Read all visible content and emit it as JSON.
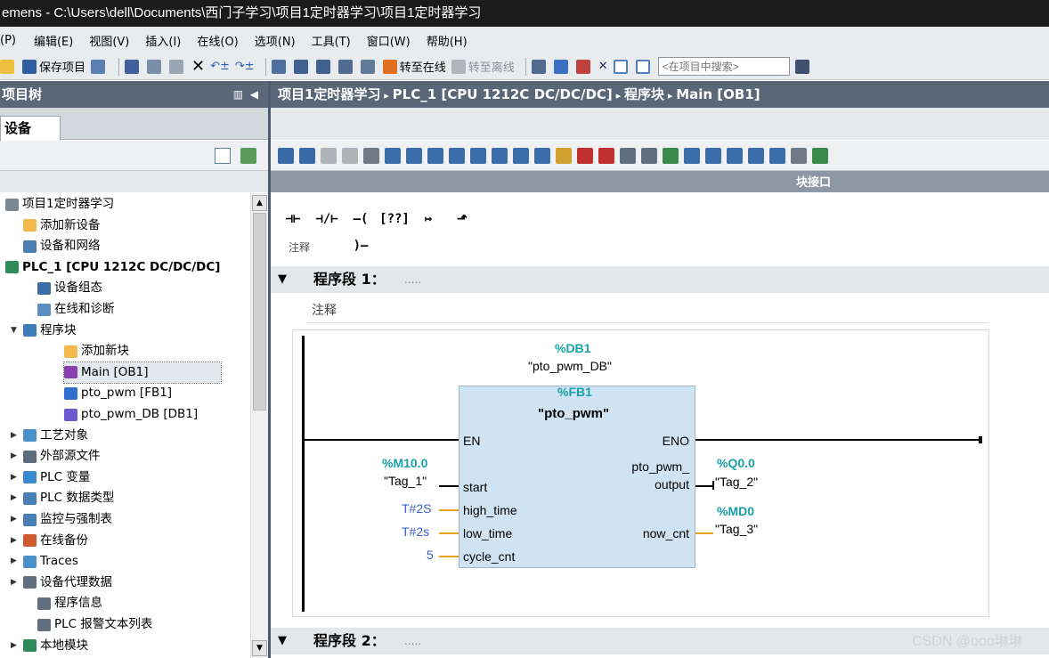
{
  "window": {
    "title": "emens  -  C:\\Users\\dell\\Documents\\西门子学习\\项目1定时器学习\\项目1定时器学习"
  },
  "menu": [
    "(P)",
    "编辑(E)",
    "视图(V)",
    "插入(I)",
    "在线(O)",
    "选项(N)",
    "工具(T)",
    "窗口(W)",
    "帮助(H)"
  ],
  "toolbar": {
    "save_label": "保存项目",
    "go_online": "转至在线",
    "go_offline": "转至离线",
    "search_placeholder": "<在项目中搜索>"
  },
  "left_pane": {
    "header": "项目树",
    "tab": "设备",
    "tree": [
      {
        "label": "项目1定时器学习",
        "level": 0,
        "arrow": "",
        "icon_color": "#7a8896"
      },
      {
        "label": "添加新设备",
        "level": 1,
        "arrow": "",
        "icon_color": "#f2b84b"
      },
      {
        "label": "设备和网络",
        "level": 1,
        "arrow": "",
        "icon_color": "#4d7fb5"
      },
      {
        "label": "PLC_1 [CPU 1212C DC/DC/DC]",
        "level": 0,
        "arrow": "▼",
        "icon_color": "#2e8b57"
      },
      {
        "label": "设备组态",
        "level": 2,
        "arrow": "",
        "icon_color": "#3a6ea5"
      },
      {
        "label": "在线和诊断",
        "level": 2,
        "arrow": "",
        "icon_color": "#5a8fc0"
      },
      {
        "label": "程序块",
        "level": 1,
        "arrow": "▼",
        "icon_color": "#3d7ab8"
      },
      {
        "label": "添加新块",
        "level": 3,
        "arrow": "",
        "icon_color": "#f2b84b"
      },
      {
        "label": "Main [OB1]",
        "level": 3,
        "arrow": "",
        "icon_color": "#8a3fb0",
        "selected": true
      },
      {
        "label": "pto_pwm [FB1]",
        "level": 3,
        "arrow": "",
        "icon_color": "#2f6fd0"
      },
      {
        "label": "pto_pwm_DB [DB1]",
        "level": 3,
        "arrow": "",
        "icon_color": "#6a5acd"
      },
      {
        "label": "工艺对象",
        "level": 1,
        "arrow": "▶",
        "icon_color": "#4a90c8"
      },
      {
        "label": "外部源文件",
        "level": 1,
        "arrow": "▶",
        "icon_color": "#5b6c7d"
      },
      {
        "label": "PLC 变量",
        "level": 1,
        "arrow": "▶",
        "icon_color": "#3b8ad0"
      },
      {
        "label": "PLC 数据类型",
        "level": 1,
        "arrow": "▶",
        "icon_color": "#4a7fb5"
      },
      {
        "label": "监控与强制表",
        "level": 1,
        "arrow": "▶",
        "icon_color": "#4a7fb5"
      },
      {
        "label": "在线备份",
        "level": 1,
        "arrow": "▶",
        "icon_color": "#d05a30"
      },
      {
        "label": "Traces",
        "level": 1,
        "arrow": "▶",
        "icon_color": "#4a90c8"
      },
      {
        "label": "设备代理数据",
        "level": 1,
        "arrow": "▶",
        "icon_color": "#607080"
      },
      {
        "label": "程序信息",
        "level": 2,
        "arrow": "",
        "icon_color": "#607080"
      },
      {
        "label": "PLC 报警文本列表",
        "level": 2,
        "arrow": "",
        "icon_color": "#607080"
      },
      {
        "label": "本地模块",
        "level": 1,
        "arrow": "▶",
        "icon_color": "#2e8b57"
      }
    ]
  },
  "breadcrumb": [
    "项目1定时器学习",
    "PLC_1 [CPU 1212C DC/DC/DC]",
    "程序块",
    "Main [OB1]"
  ],
  "block_interface_label": "块接口",
  "ladder_elements": [
    "⊣⊢",
    "⊣/⊢",
    "–( )–",
    "[??]",
    "↦",
    "⬏"
  ],
  "editor": {
    "top_comment": "注释",
    "network1": {
      "title": "程序段 1：",
      "dots": ".....",
      "comment": "注释"
    },
    "network2": {
      "title": "程序段 2：",
      "dots": "....."
    }
  },
  "fb": {
    "db_addr": "%DB1",
    "db_name": "\"pto_pwm_DB\"",
    "fb_addr": "%FB1",
    "fb_name": "\"pto_pwm\"",
    "en": "EN",
    "eno": "ENO",
    "in_start": "start",
    "in_high": "high_time",
    "in_low": "low_time",
    "in_cycle": "cycle_cnt",
    "out_output_1": "pto_pwm_",
    "out_output_2": "output",
    "out_now": "now_cnt",
    "start_addr": "%M10.0",
    "start_tag": "\"Tag_1\"",
    "high_val": "T#2S",
    "low_val": "T#2s",
    "cycle_val": "5",
    "out_addr": "%Q0.0",
    "out_tag": "\"Tag_2\"",
    "now_addr": "%MD0",
    "now_tag": "\"Tag_3\""
  },
  "watermark": "CSDN @ooo琳琳"
}
